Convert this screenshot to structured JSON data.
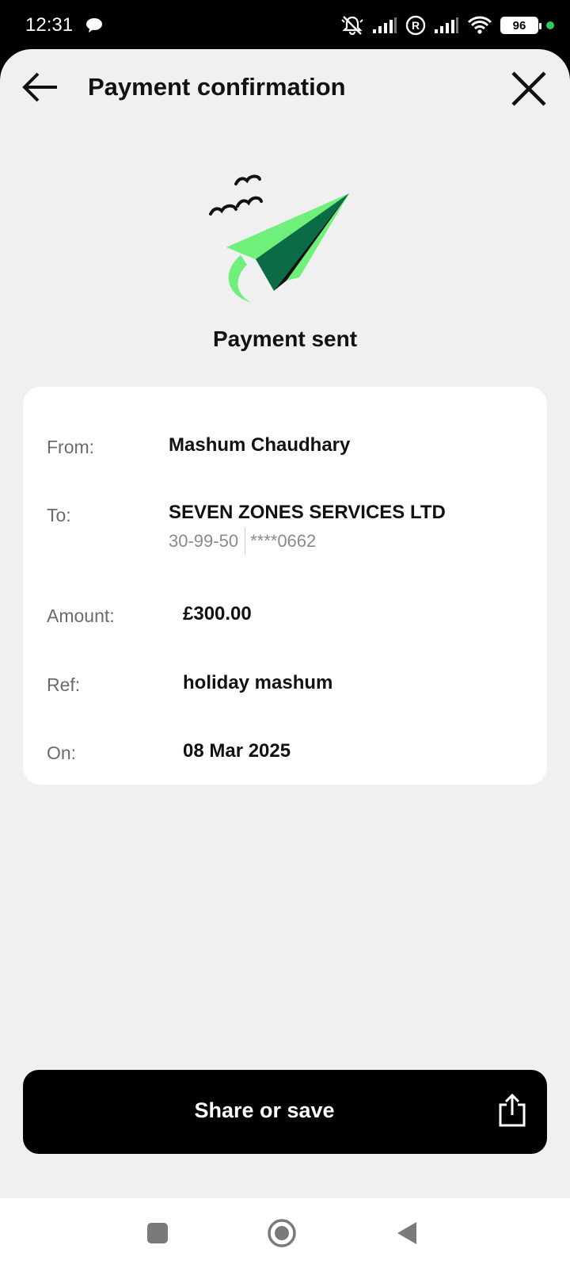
{
  "status_bar": {
    "time": "12:31",
    "battery": "96",
    "icons": [
      "chat-bubble-icon",
      "muted-bell-icon",
      "signal-icon",
      "registered-icon",
      "signal-icon",
      "wifi-icon",
      "battery-icon"
    ],
    "dot_color": "#2ecc55"
  },
  "header": {
    "title": "Payment confirmation",
    "back_icon": "back-arrow-icon",
    "close_icon": "close-icon"
  },
  "hero": {
    "icon": "paper-plane-icon",
    "heading": "Payment sent",
    "accent_colors": [
      "#6ef07a",
      "#0a6b47"
    ]
  },
  "details": {
    "from_label": "From:",
    "from_value": "Mashum Chaudhary",
    "to_label": "To:",
    "to_value": "SEVEN ZONES SERVICES LTD",
    "sort_code": "30-99-50",
    "account": "****0662",
    "amount_label": "Amount:",
    "amount_value": "£300.00",
    "ref_label": "Ref:",
    "ref_value": "holiday mashum",
    "on_label": "On:",
    "on_value": "08 Mar 2025"
  },
  "actions": {
    "share_label": "Share or save",
    "share_icon": "share-icon"
  },
  "nav_bar": {
    "items": [
      "recents-square-icon",
      "home-circle-icon",
      "back-triangle-icon"
    ]
  }
}
